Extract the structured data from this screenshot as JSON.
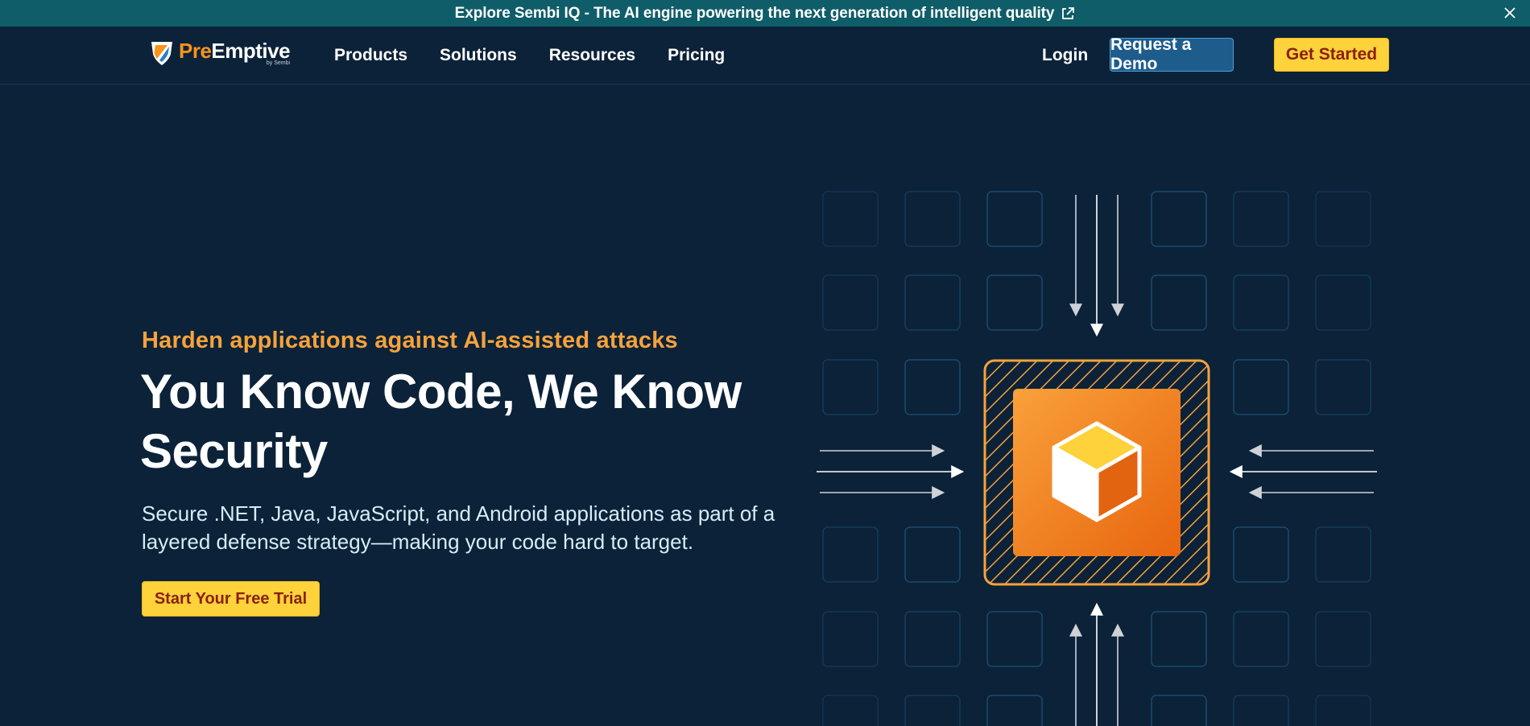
{
  "announcement": {
    "text": "Explore Sembi IQ - The AI engine powering the next generation of intelligent quality",
    "external_icon": "external-link-icon",
    "close_icon": "close-icon"
  },
  "header": {
    "logo": {
      "pre": "Pre",
      "emp": "Emptive",
      "sub": "by Sembi"
    },
    "nav": [
      "Products",
      "Solutions",
      "Resources",
      "Pricing"
    ],
    "login": "Login",
    "demo_button": "Request a Demo",
    "start_button": "Get Started"
  },
  "hero": {
    "eyebrow": "Harden applications against AI-assisted attacks",
    "headline": "You Know Code, We Know Security",
    "subtext": "Secure .NET, Java, JavaScript, and Android applications as part of a layered defense strategy—making your code hard to target.",
    "cta": "Start Your Free Trial",
    "illustration_icon": "cube-icon"
  },
  "colors": {
    "background": "#0b2239",
    "announcement_bar": "#0f5d68",
    "accent_orange": "#f7a23a",
    "cta_yellow": "#fdd23a",
    "cta_text": "#8b1f10",
    "demo_blue": "#1e5c8c"
  }
}
